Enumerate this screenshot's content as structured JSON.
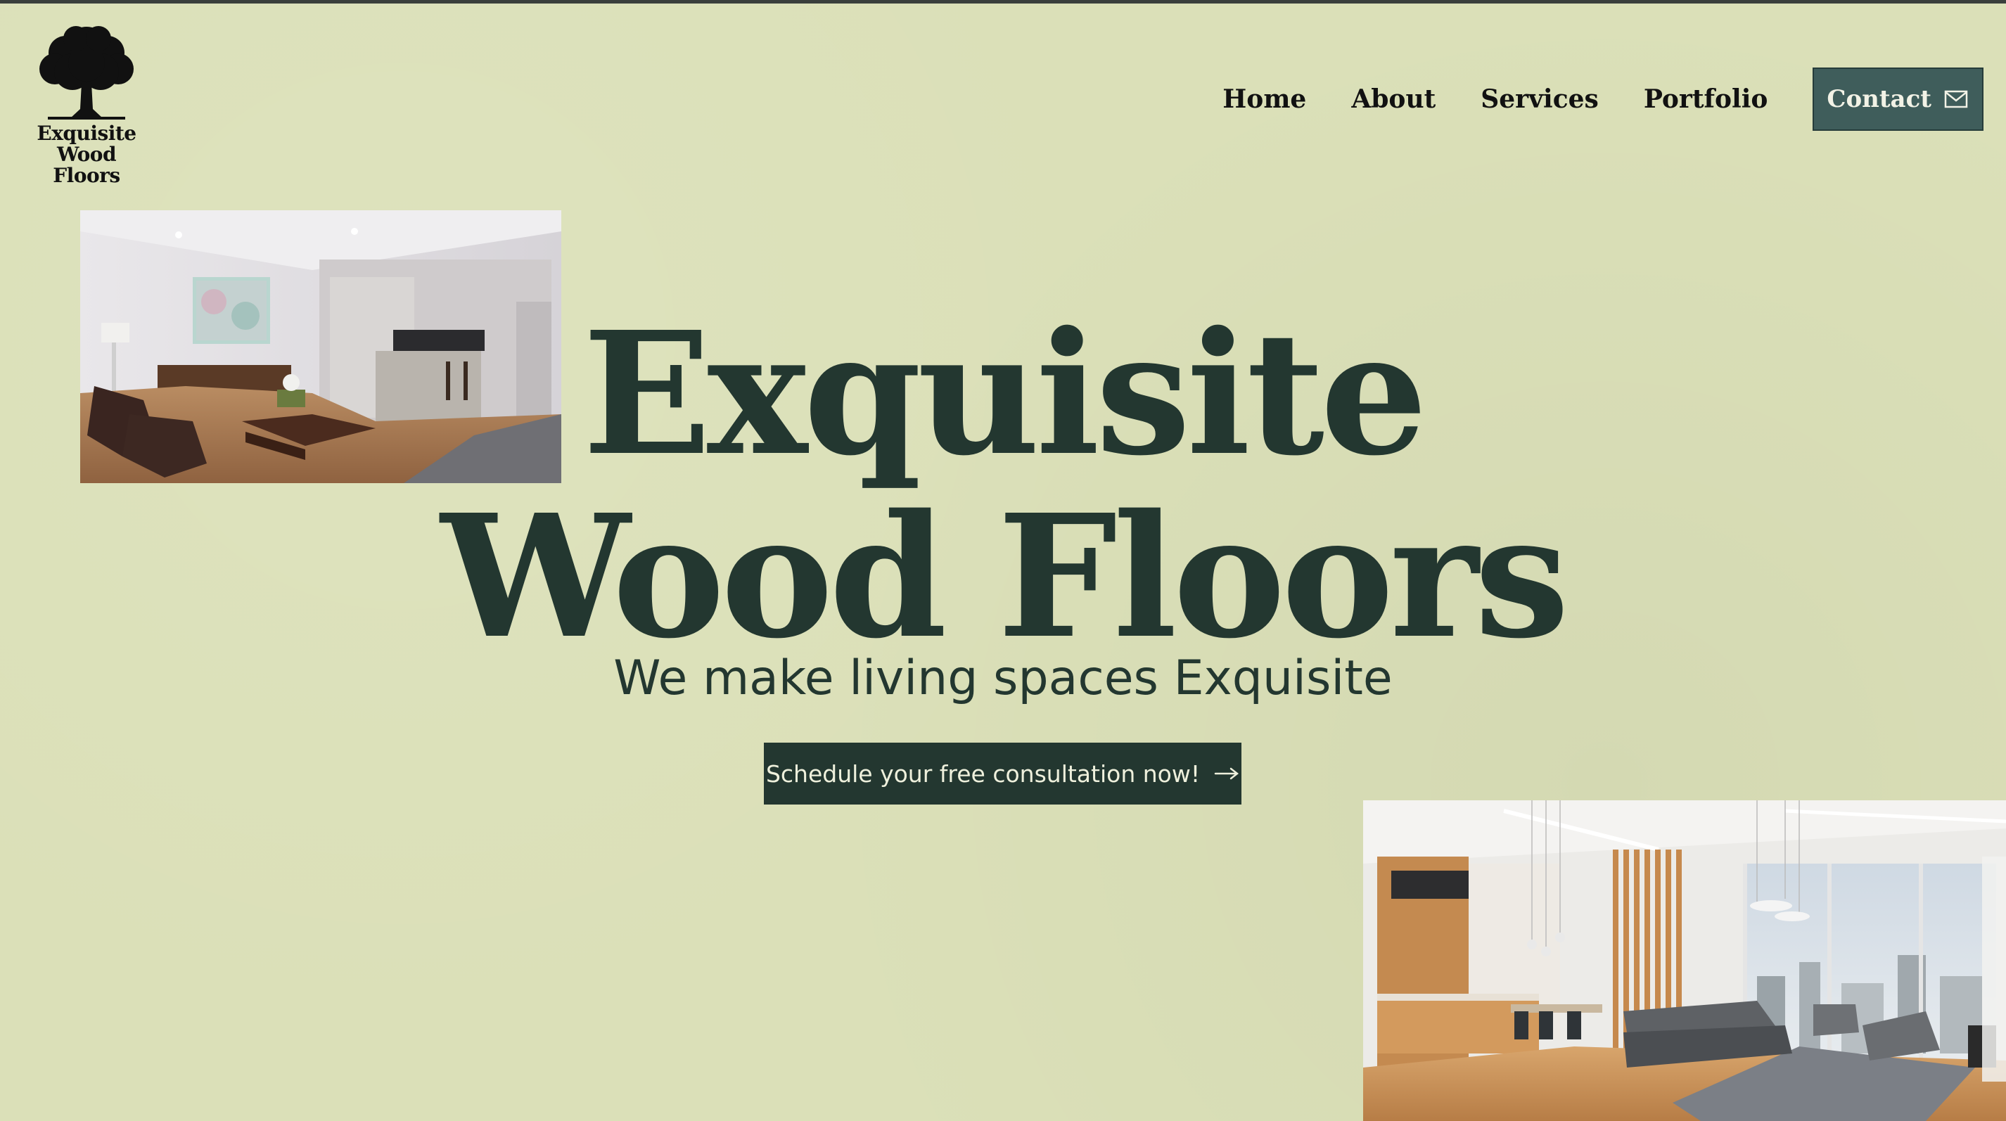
{
  "brand": {
    "logo_line1": "Exquisite",
    "logo_line2": "Wood Floors"
  },
  "nav": {
    "items": [
      {
        "label": "Home"
      },
      {
        "label": "About"
      },
      {
        "label": "Services"
      },
      {
        "label": "Portfolio"
      }
    ],
    "contact_label": "Contact"
  },
  "hero": {
    "title_line1": "Exquisite",
    "title_line2": "Wood Floors",
    "subtitle": "We make living spaces Exquisite",
    "cta_label": "Schedule your free consultation now!"
  },
  "icons": {
    "logo": "oak-tree-icon",
    "contact": "mail-icon",
    "cta": "arrow-right-icon"
  },
  "colors": {
    "background": "#dbe0b8",
    "text_dark": "#233730",
    "contact_button": "#3f5d5b",
    "cta_button": "#233730"
  }
}
